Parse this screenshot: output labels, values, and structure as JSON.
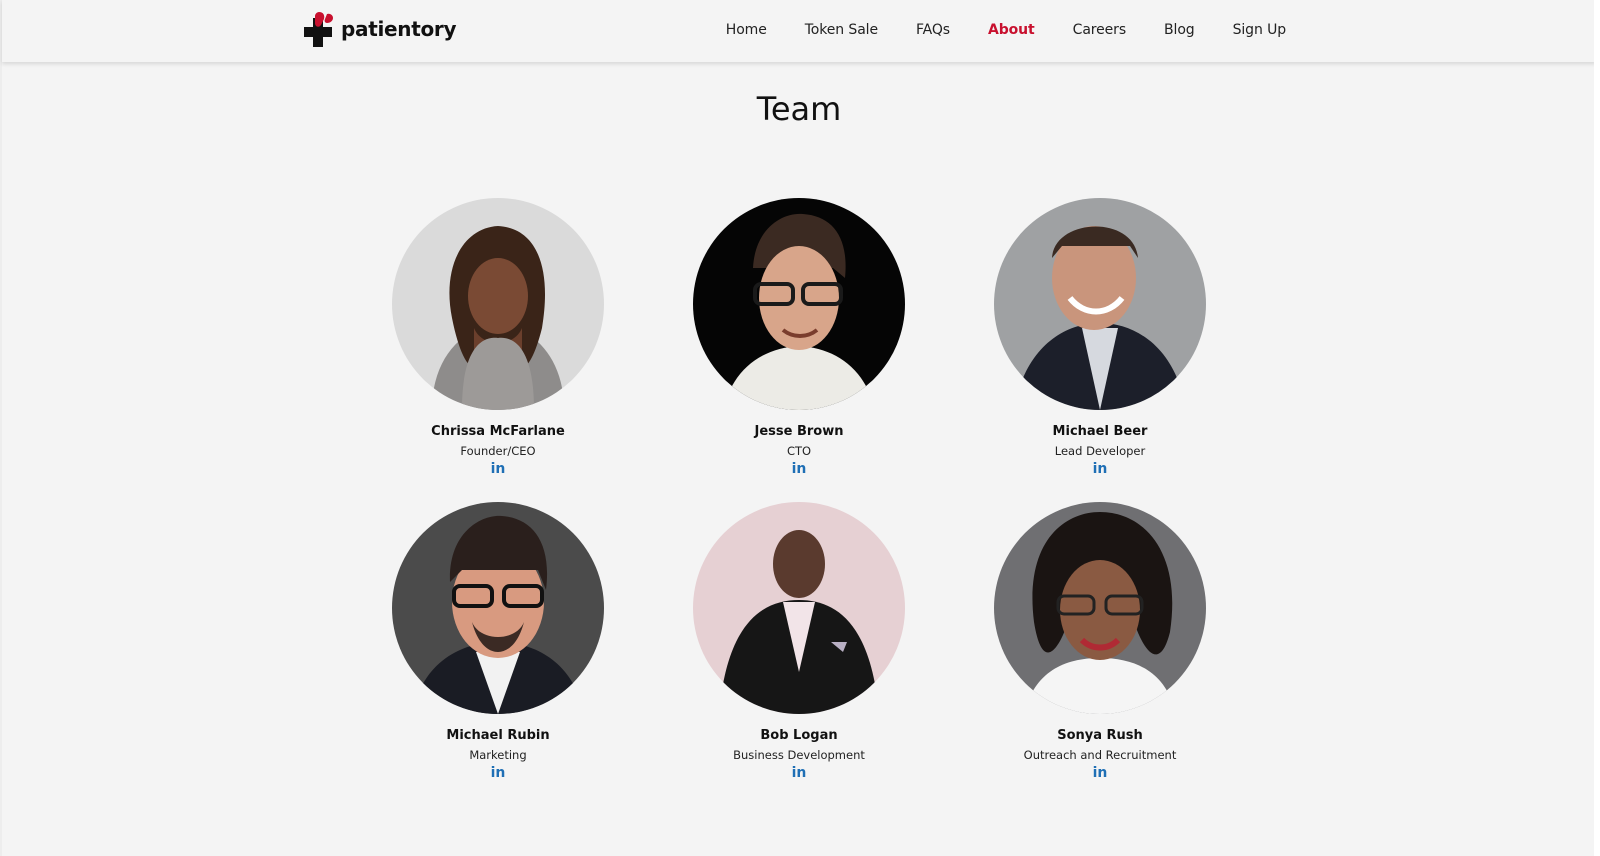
{
  "brand": {
    "name": "patientory",
    "accent": "#c8102e"
  },
  "nav": {
    "items": [
      {
        "label": "Home",
        "active": false
      },
      {
        "label": "Token Sale",
        "active": false
      },
      {
        "label": "FAQs",
        "active": false
      },
      {
        "label": "About",
        "active": true
      },
      {
        "label": "Careers",
        "active": false
      },
      {
        "label": "Blog",
        "active": false
      },
      {
        "label": "Sign Up",
        "active": false
      }
    ]
  },
  "page": {
    "title": "Team"
  },
  "team": [
    {
      "name": "Chrissa McFarlane",
      "role": "Founder/CEO",
      "social": "in",
      "social_icon": "linkedin-icon"
    },
    {
      "name": "Jesse Brown",
      "role": "CTO",
      "social": "in",
      "social_icon": "linkedin-icon"
    },
    {
      "name": "Michael Beer",
      "role": "Lead Developer",
      "social": "in",
      "social_icon": "linkedin-icon"
    },
    {
      "name": "Michael Rubin",
      "role": "Marketing",
      "social": "in",
      "social_icon": "linkedin-icon"
    },
    {
      "name": "Bob Logan",
      "role": "Business Development",
      "social": "in",
      "social_icon": "linkedin-icon"
    },
    {
      "name": "Sonya Rush",
      "role": "Outreach and Recruitment",
      "social": "in",
      "social_icon": "linkedin-icon"
    }
  ],
  "colors": {
    "link": "#1f6fb5",
    "text": "#111111",
    "background": "#f4f4f4"
  }
}
